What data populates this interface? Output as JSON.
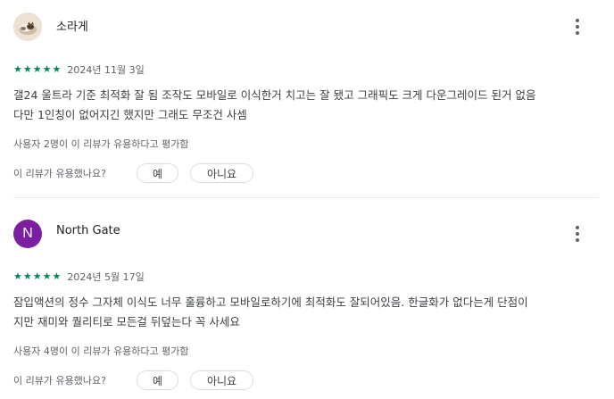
{
  "reviews": [
    {
      "name": "소라게",
      "avatar": {
        "type": "photo",
        "icon": "cat-photo"
      },
      "stars": [
        "★",
        "★",
        "★",
        "★",
        "★"
      ],
      "rating": 5,
      "date": "2024년 11월 3일",
      "text_lines": [
        "갤24 울트라 기준 최적화 잘 됨 조작도 모바일로 이식한거 치고는 잘 됐고 그래픽도 크게 다운그레이드 된거 없음",
        "다만 1인칭이 없어지긴 했지만 그래도 무조건 사셈"
      ],
      "helpful_count": "사용자 2명이 이 리뷰가 유용하다고 평가함",
      "helpful_question": "이 리뷰가 유용했나요?",
      "yes_label": "예",
      "no_label": "아니요"
    },
    {
      "name": "North Gate",
      "avatar": {
        "type": "letter",
        "letter": "N",
        "color": "#7b1fa2"
      },
      "stars": [
        "★",
        "★",
        "★",
        "★",
        "★"
      ],
      "rating": 5,
      "date": "2024년 5월 17일",
      "text_lines": [
        "잠입액션의 정수 그자체 이식도 너무 훌륭하고 모바일로하기에 최적화도 잘되어있음. 한글화가 없다는게 단점이",
        "지만 재미와 퀄리티로 모든걸 뒤덮는다 꼭 사세요"
      ],
      "helpful_count": "사용자 4명이 이 리뷰가 유용하다고 평가함",
      "helpful_question": "이 리뷰가 유용했나요?",
      "yes_label": "예",
      "no_label": "아니요"
    }
  ],
  "colors": {
    "star": "#01875f",
    "divider": "#e8eaed",
    "secondary_text": "#5f6368"
  }
}
